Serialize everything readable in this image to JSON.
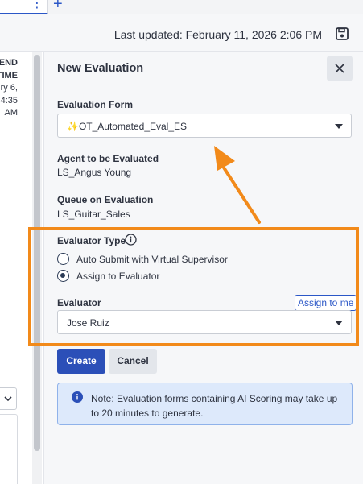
{
  "header": {
    "last_updated": "Last updated: February 11, 2026 2:06 PM"
  },
  "left_panel": {
    "lines": [
      {
        "text": "END",
        "bold": true
      },
      {
        "text": "TIME",
        "bold": true
      },
      {
        "text": "ry 6,",
        "bold": false
      },
      {
        "text": "4:35",
        "bold": false
      },
      {
        "text": "AM",
        "bold": false
      }
    ]
  },
  "panel": {
    "title": "New Evaluation",
    "evaluation_form": {
      "label": "Evaluation Form",
      "value": "✨OT_Automated_Eval_ES"
    },
    "agent": {
      "label": "Agent to be Evaluated",
      "value": "LS_Angus Young"
    },
    "queue": {
      "label": "Queue on Evaluation",
      "value": "LS_Guitar_Sales"
    },
    "evaluator_type": {
      "label": "Evaluator Type",
      "options": [
        {
          "label": "Auto Submit with Virtual Supervisor",
          "selected": false
        },
        {
          "label": "Assign to Evaluator",
          "selected": true
        }
      ]
    },
    "evaluator": {
      "label": "Evaluator",
      "assign_to_me": "Assign to me",
      "value": "Jose Ruiz"
    },
    "buttons": {
      "create": "Create",
      "cancel": "Cancel"
    },
    "note": "Note: Evaluation forms containing AI Scoring may take up to 20 minutes to generate."
  },
  "colors": {
    "accent": "#2b4fb8",
    "annotation": "#f28a1a",
    "note_bg": "#dde9fb"
  }
}
